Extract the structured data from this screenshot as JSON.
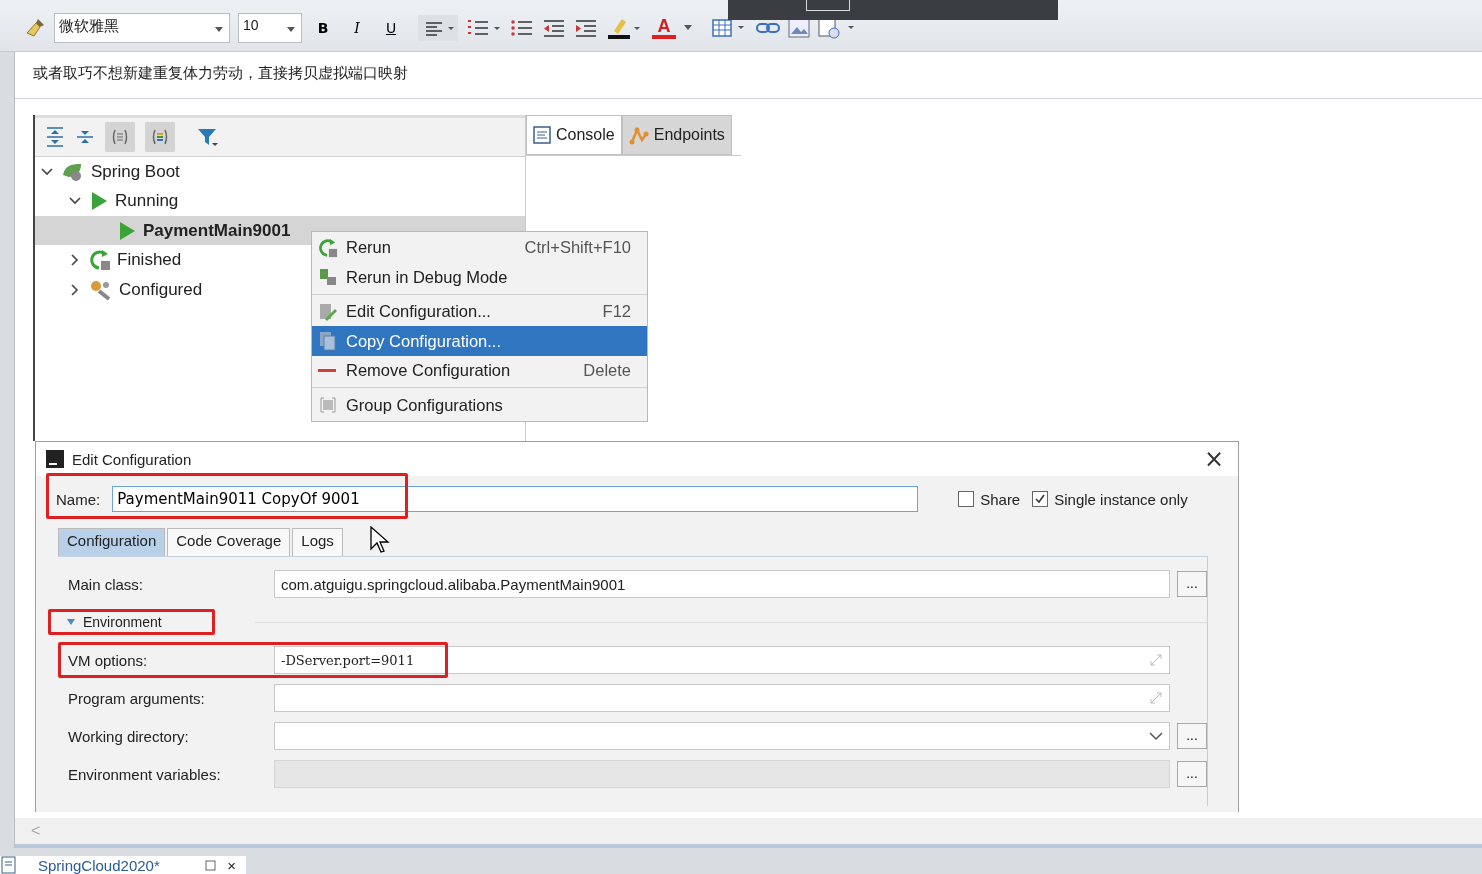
{
  "editor_toolbar": {
    "font": "微软雅黑",
    "size": "10",
    "format_buttons": [
      "B",
      "I",
      "U"
    ],
    "font_color_label": "A"
  },
  "note_text": "或者取巧不想新建重复体力劳动，直接拷贝虚拟端口映射",
  "run_panel_tabs": [
    {
      "label": "Console",
      "selected": true,
      "kind": "console"
    },
    {
      "label": "Endpoints",
      "selected": false,
      "kind": "endpoints"
    }
  ],
  "tree": [
    {
      "label": "Spring Boot",
      "kind": "spring",
      "expanded": true,
      "selected": false,
      "children": [
        {
          "label": "Running",
          "kind": "run",
          "expanded": true,
          "selected": false,
          "children": [
            {
              "label": "PaymentMain9001",
              "kind": "run",
              "selected": true
            }
          ]
        },
        {
          "label": "Finished",
          "kind": "rerun",
          "expanded": false,
          "selected": false
        },
        {
          "label": "Configured",
          "kind": "config",
          "expanded": false,
          "selected": false
        }
      ]
    }
  ],
  "context_menu": [
    {
      "items": [
        {
          "label": "Rerun",
          "shortcut": "Ctrl+Shift+F10",
          "kind": "rerun",
          "selected": false
        },
        {
          "label": "Rerun in Debug Mode",
          "kind": "debug",
          "selected": false
        }
      ]
    },
    {
      "items": [
        {
          "label": "Edit Configuration...",
          "shortcut": "F12",
          "kind": "edit",
          "selected": false
        },
        {
          "label": "Copy Configuration...",
          "kind": "copy",
          "selected": true
        },
        {
          "label": "Remove Configuration",
          "shortcut": "Delete",
          "kind": "remove",
          "selected": false
        }
      ]
    },
    {
      "items": [
        {
          "label": "Group Configurations",
          "kind": "group",
          "selected": false
        }
      ]
    }
  ],
  "dialog": {
    "title": "Edit Configuration",
    "close": "×",
    "name_label": "Name:",
    "name_value": "PaymentMain9011 CopyOf 9001",
    "name_highlighted": true,
    "checkboxes": [
      {
        "label": "Share",
        "checked": false
      },
      {
        "label": "Single instance only",
        "checked": true
      }
    ],
    "tabs": [
      {
        "label": "Configuration",
        "selected": true
      },
      {
        "label": "Code Coverage",
        "selected": false
      },
      {
        "label": "Logs",
        "selected": false
      }
    ],
    "main_class": {
      "label": "Main class:",
      "value": "com.atguigu.springcloud.alibaba.PaymentMain9001",
      "button": "..."
    },
    "section": {
      "label": "Environment",
      "expanded": true,
      "highlighted": true
    },
    "fields": [
      {
        "label": "VM options:",
        "value": "-DServer.port=9011",
        "kind": "expand",
        "highlighted": true,
        "disabled": false
      },
      {
        "label": "Program arguments:",
        "kind": "expand",
        "highlighted": false,
        "disabled": false
      },
      {
        "label": "Working directory:",
        "kind": "dropdown",
        "button": "...",
        "highlighted": false,
        "disabled": false
      },
      {
        "label": "Environment variables:",
        "kind": "browse",
        "button": "...",
        "highlighted": false,
        "disabled": true
      }
    ]
  },
  "scroll_arrow": "<",
  "bottom_tab": {
    "label": "SpringCloud2020*",
    "close": "×"
  }
}
